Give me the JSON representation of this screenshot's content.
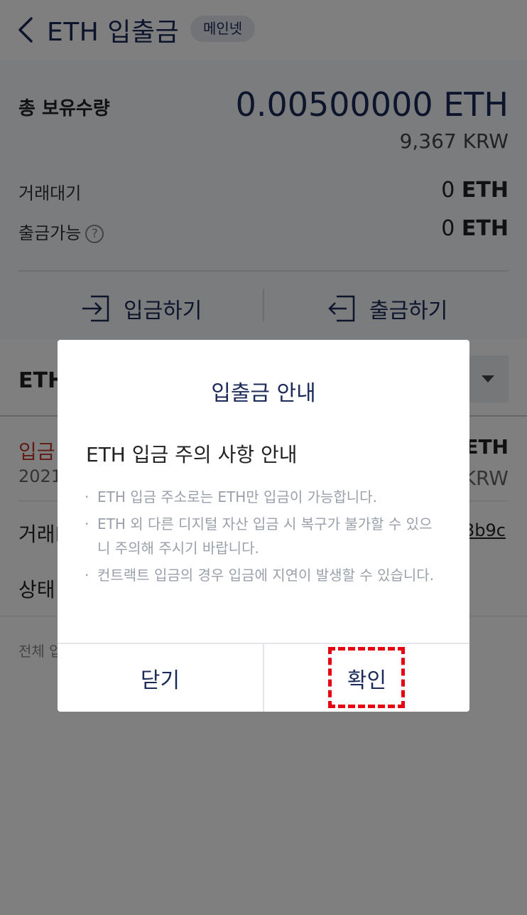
{
  "header": {
    "title": "ETH 입출금",
    "network_badge": "메인넷"
  },
  "balance": {
    "total_label": "총 보유수량",
    "total_amount": "0.00500000",
    "total_unit": "ETH",
    "total_krw": "9,367 KRW",
    "pending_label": "거래대기",
    "pending_value": "0",
    "pending_unit": "ETH",
    "withdrawable_label": "출금가능",
    "withdrawable_value": "0",
    "withdrawable_unit": "ETH",
    "deposit_button": "입금하기",
    "withdraw_button": "출금하기"
  },
  "background": {
    "section_title": "ETH",
    "list_type": "입금",
    "list_date": "2021",
    "list_amount_unit": "ETH",
    "list_krw": "KRW",
    "txid_label": "거래I",
    "txid_value": "3b9c",
    "status_label": "상태",
    "footer_note": "전체 입"
  },
  "modal": {
    "title": "입출금 안내",
    "subtitle": "ETH 입금 주의 사항 안내",
    "notices": [
      "ETH 입금 주소로는 ETH만 입금이 가능합니다.",
      "ETH 외 다른 디지털 자산 입금 시 복구가 불가할 수 있으니 주의해 주시기 바랍니다.",
      "컨트랙트 입금의 경우 입금에 지연이 발생할 수 있습니다."
    ],
    "close_button": "닫기",
    "confirm_button": "확인"
  },
  "colors": {
    "brand_navy": "#1b2a58",
    "highlight_red": "#e60012",
    "overlay": "rgba(0,0,0,0.5)"
  }
}
